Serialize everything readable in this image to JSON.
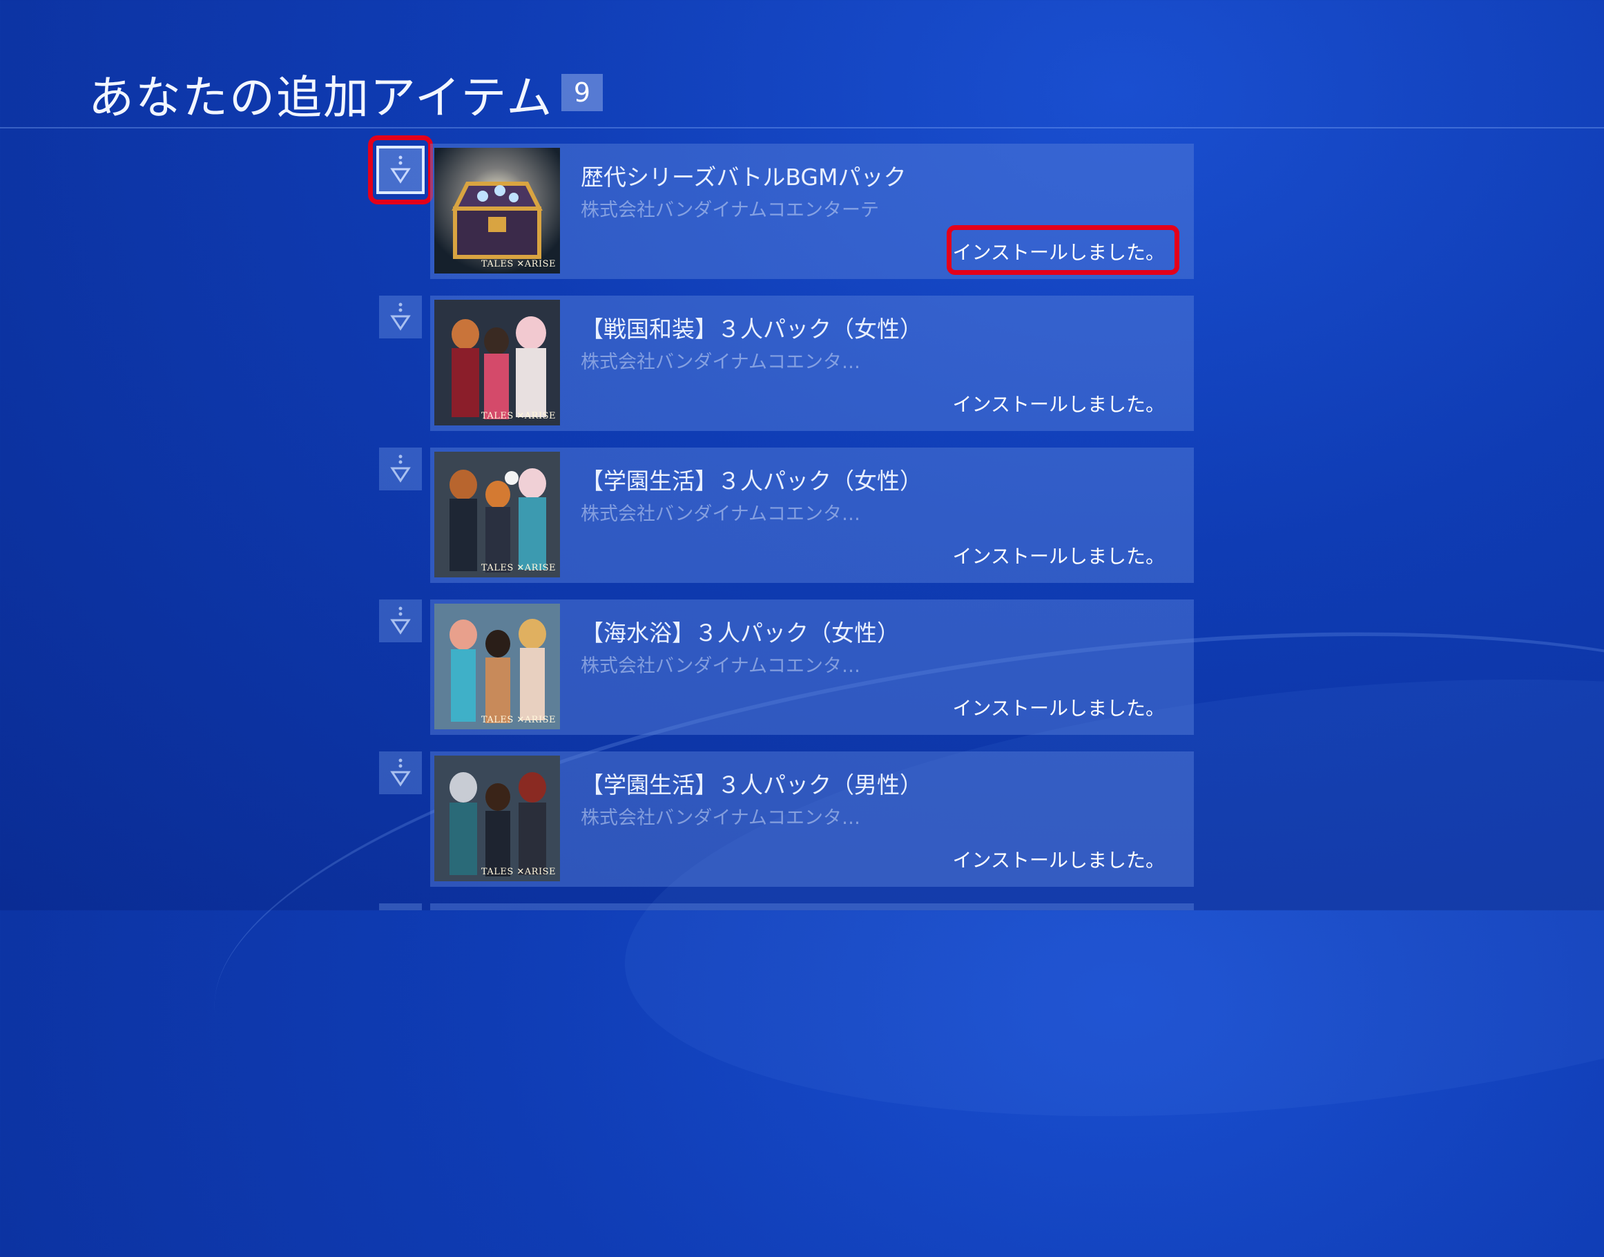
{
  "header": {
    "title": "あなたの追加アイテム",
    "count": "9"
  },
  "items": [
    {
      "title": "歴代シリーズバトルBGMパック",
      "publisher": "株式会社バンダイナムコエンターテ",
      "status": "インストールしました。",
      "thumb_logo": "TALES ✕ARISE",
      "thumb_icon": "treasure-chest"
    },
    {
      "title": "【戦国和装】３人パック（女性）",
      "publisher": "株式会社バンダイナムコエンタ…",
      "status": "インストールしました。",
      "thumb_logo": "TALES ✕ARISE",
      "thumb_icon": "characters-sengoku"
    },
    {
      "title": "【学園生活】３人パック（女性）",
      "publisher": "株式会社バンダイナムコエンタ…",
      "status": "インストールしました。",
      "thumb_logo": "TALES ✕ARISE",
      "thumb_icon": "characters-school-female"
    },
    {
      "title": "【海水浴】３人パック（女性）",
      "publisher": "株式会社バンダイナムコエンタ…",
      "status": "インストールしました。",
      "thumb_logo": "TALES ✕ARISE",
      "thumb_icon": "characters-beach"
    },
    {
      "title": "【学園生活】３人パック（男性）",
      "publisher": "株式会社バンダイナムコエンタ…",
      "status": "インストールしました。",
      "thumb_logo": "TALES ✕ARISE",
      "thumb_icon": "characters-school-male"
    }
  ],
  "colors": {
    "background": "#0f3cb4",
    "highlight": "#e4001a",
    "card": "#5a82dc"
  }
}
